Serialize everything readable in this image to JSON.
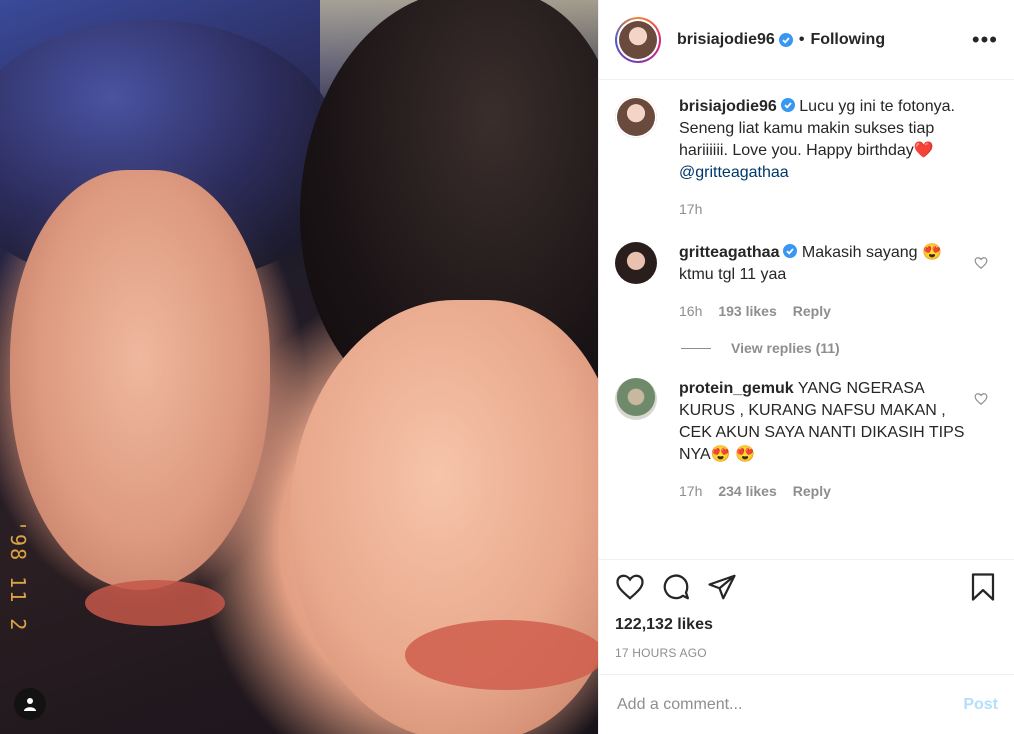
{
  "photo": {
    "date_stamp": "'98 11 2"
  },
  "header": {
    "username": "brisiajodie96",
    "separator": "•",
    "follow_status": "Following",
    "more": "•••"
  },
  "caption": {
    "username": "brisiajodie96",
    "text": "Lucu yg ini te fotonya. Seneng liat kamu makin sukses tiap hariiiiii. Love you. Happy birthday❤️",
    "mention": "@gritteagathaa",
    "time": "17h"
  },
  "comments": [
    {
      "username": "gritteagathaa",
      "text": "Makasih sayang 😍 ktmu tgl 11 yaa",
      "time": "16h",
      "likes": "193 likes",
      "reply": "Reply",
      "view_replies": "View replies (11)"
    },
    {
      "username": "protein_gemuk",
      "text": "YANG NGERASA KURUS , KURANG NAFSU MAKAN , CEK AKUN SAYA NANTI DIKASIH TIPS NYA😍 😍",
      "time": "17h",
      "likes": "234 likes",
      "reply": "Reply"
    }
  ],
  "actions": {
    "likes": "122,132 likes",
    "timestamp": "17 HOURS AGO"
  },
  "add_comment": {
    "placeholder": "Add a comment...",
    "post_label": "Post"
  },
  "colors": {
    "link": "#00376b",
    "muted": "#8e8e8e",
    "post_disabled": "#b2dffc",
    "verified": "#3897f0"
  }
}
